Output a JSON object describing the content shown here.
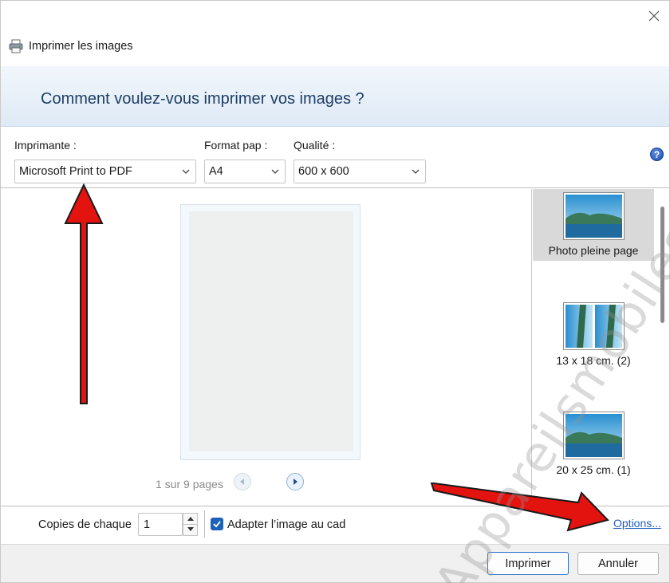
{
  "window": {
    "title": "Imprimer les images",
    "close_icon": "close-icon",
    "app_icon": "printer-icon"
  },
  "banner": {
    "heading": "Comment voulez-vous imprimer vos images ?"
  },
  "printer": {
    "label": "Imprimante :",
    "value": "Microsoft Print to PDF"
  },
  "paper": {
    "label": "Format pap :",
    "value": "A4"
  },
  "quality": {
    "label": "Qualité :",
    "value": "600 x 600"
  },
  "help": {
    "glyph": "?",
    "icon": "help-icon"
  },
  "pager": {
    "text": "1 sur 9 pages",
    "prev_icon": "chevron-left-icon",
    "next_icon": "play-next-icon"
  },
  "layouts": [
    {
      "label": "Photo pleine page",
      "selected": true
    },
    {
      "label": "13 x 18 cm. (2)",
      "selected": false
    },
    {
      "label": "20 x 25 cm. (1)",
      "selected": false
    }
  ],
  "copies": {
    "label": "Copies de chaque",
    "value": "1"
  },
  "fit": {
    "label": "Adapter l’image au cad",
    "checked": true
  },
  "options_link": "Options...",
  "buttons": {
    "print": "Imprimer",
    "cancel": "Annuler"
  },
  "annotations": {
    "watermark": "Appareilsmobiles.fr",
    "arrow_color": "#e3130f"
  },
  "colors": {
    "accent": "#1e62b8",
    "banner_text": "#1e3f66",
    "link": "#1f5fbf"
  }
}
